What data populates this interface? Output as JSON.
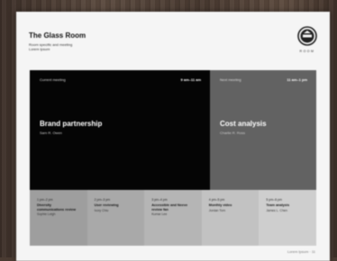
{
  "header": {
    "venue_name": "The Glass Room",
    "venue_sub": "Room specific and meeting Lorem Ipsum"
  },
  "logo": {
    "text": "ROOM"
  },
  "current": {
    "status": "Current meeting",
    "time": "9 am–11 am",
    "title": "Brand partnership",
    "host": "Sam R. Owen"
  },
  "next": {
    "status": "Next meeting",
    "time": "11 am–1 pm",
    "title": "Cost analysis",
    "host": "Charlie R. Ross"
  },
  "upcoming": [
    {
      "time": "1 pm–2 pm",
      "title": "Diversity communications review",
      "host": "Sophie Leigh",
      "color": "#9e9e9e"
    },
    {
      "time": "2 pm–3 pm",
      "title": "User reviewing",
      "host": "Ivory Chiu",
      "color": "#a9a9a9"
    },
    {
      "time": "3 pm–4 pm",
      "title": "Accessible and Neeve review fan",
      "host": "Kumar Lee",
      "color": "#b5b5b5"
    },
    {
      "time": "4 pm–5 pm",
      "title": "Monthly video",
      "host": "Jordan Tom",
      "color": "#c2c2c2"
    },
    {
      "time": "5 pm–6 pm",
      "title": "Team analysis",
      "host": "James L. Chen",
      "color": "#cecece"
    }
  ],
  "footer": {
    "text": "Lorem Ipsum · 11"
  },
  "colors": {
    "current_bg": "#050505",
    "next_bg": "#626262",
    "panel_bg": "#f5f5f5"
  }
}
